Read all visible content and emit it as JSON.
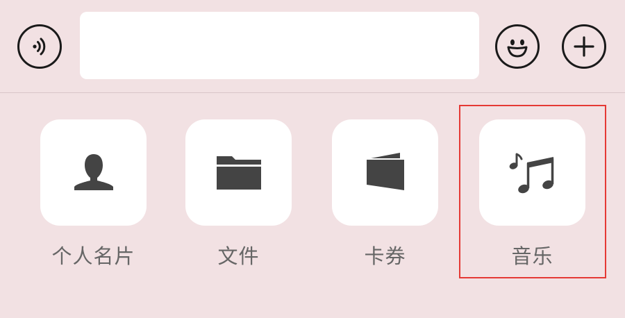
{
  "input_bar": {
    "text_value": "",
    "voice_icon": "voice-wave-icon",
    "emoji_icon": "smiley-face-icon",
    "plus_icon": "plus-icon"
  },
  "panel": {
    "items": [
      {
        "label": "个人名片",
        "icon": "person-icon"
      },
      {
        "label": "文件",
        "icon": "folder-icon"
      },
      {
        "label": "卡券",
        "icon": "wallet-card-icon"
      },
      {
        "label": "音乐",
        "icon": "music-notes-icon"
      }
    ]
  },
  "colors": {
    "background": "#f2e1e3",
    "tile": "#ffffff",
    "icon": "#444444",
    "label": "#666666",
    "highlight": "#e53935"
  }
}
